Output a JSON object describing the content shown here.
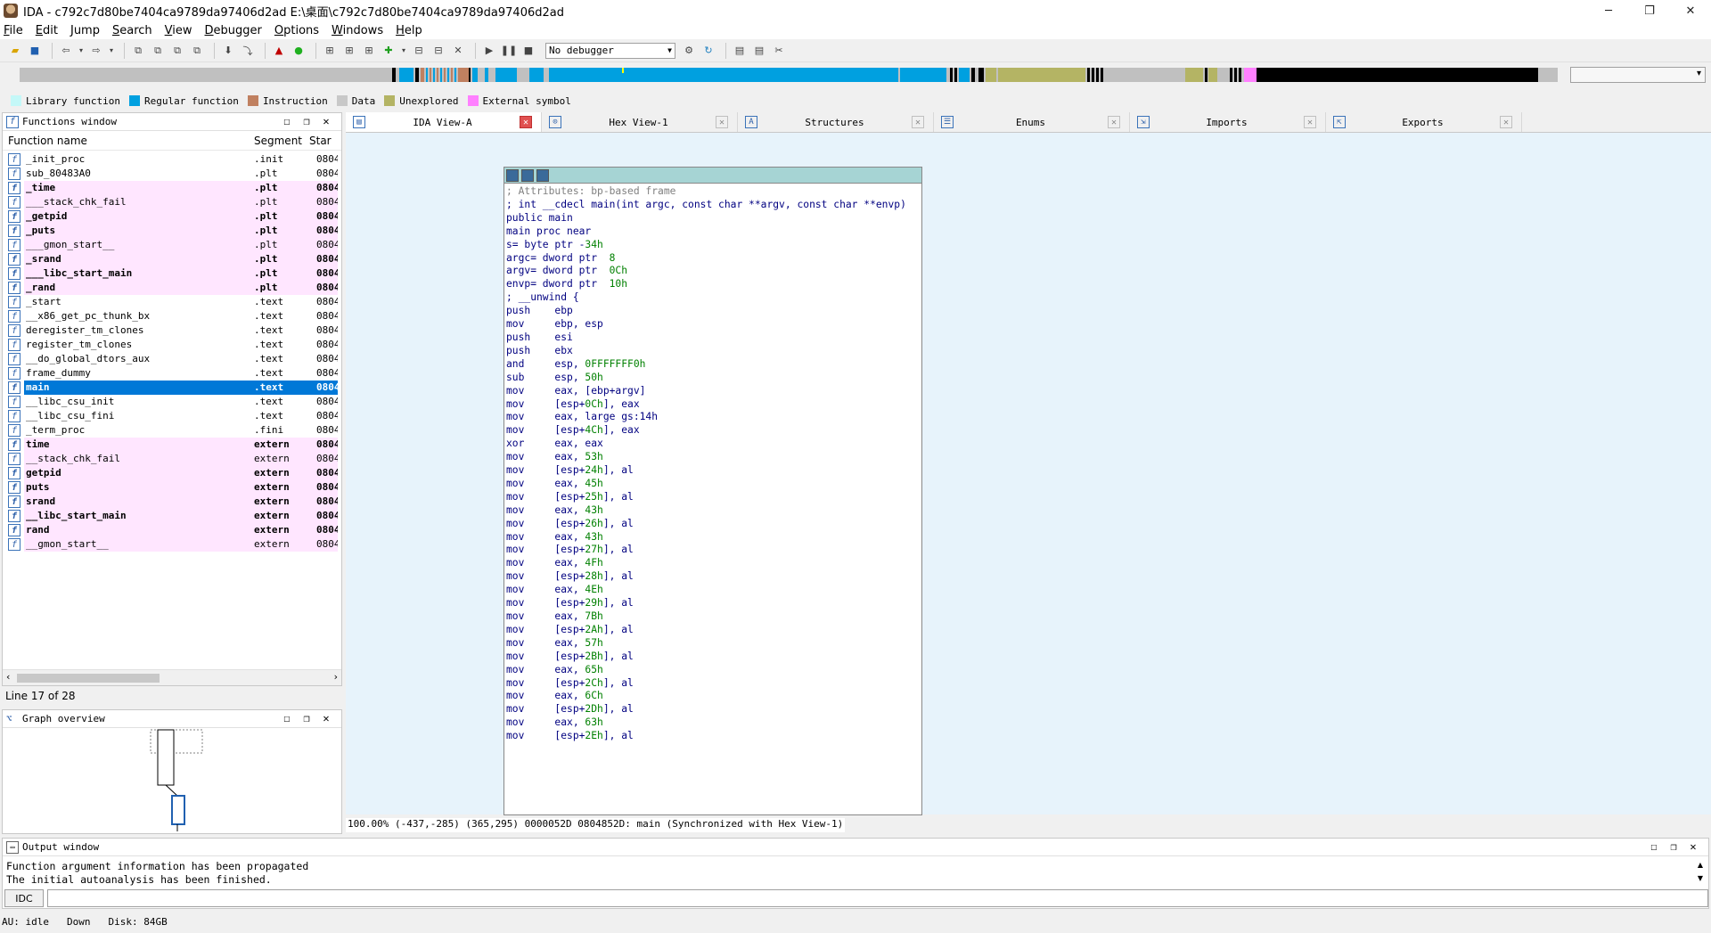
{
  "window": {
    "title": "IDA - c792c7d80be7404ca9789da97406d2ad E:\\桌面\\c792c7d80be7404ca9789da97406d2ad",
    "minimize": "─",
    "restore": "❐",
    "close": "✕"
  },
  "menu": [
    "File",
    "Edit",
    "Jump",
    "Search",
    "View",
    "Debugger",
    "Options",
    "Windows",
    "Help"
  ],
  "toolbar": {
    "debugger_select": "No debugger"
  },
  "legend": [
    {
      "label": "Library function",
      "color": "#c4f8f8"
    },
    {
      "label": "Regular function",
      "color": "#00a0e0"
    },
    {
      "label": "Instruction",
      "color": "#c08060"
    },
    {
      "label": "Data",
      "color": "#c8c8c8"
    },
    {
      "label": "Unexplored",
      "color": "#b4b464"
    },
    {
      "label": "External symbol",
      "color": "#ff80ff"
    }
  ],
  "functions_window": {
    "title": "Functions window",
    "col_name": "Function name",
    "col_segment": "Segment",
    "col_start": "Star",
    "rows": [
      {
        "name": "_init_proc",
        "segment": ".init",
        "start": "0804",
        "bold": false,
        "ext": false
      },
      {
        "name": "sub_80483A0",
        "segment": ".plt",
        "start": "0804",
        "bold": false,
        "ext": false
      },
      {
        "name": "_time",
        "segment": ".plt",
        "start": "0804",
        "bold": true,
        "ext": true
      },
      {
        "name": "___stack_chk_fail",
        "segment": ".plt",
        "start": "0804",
        "bold": false,
        "ext": true
      },
      {
        "name": "_getpid",
        "segment": ".plt",
        "start": "0804",
        "bold": true,
        "ext": true
      },
      {
        "name": "_puts",
        "segment": ".plt",
        "start": "0804",
        "bold": true,
        "ext": true
      },
      {
        "name": "___gmon_start__",
        "segment": ".plt",
        "start": "0804",
        "bold": false,
        "ext": true
      },
      {
        "name": "_srand",
        "segment": ".plt",
        "start": "0804",
        "bold": true,
        "ext": true
      },
      {
        "name": "___libc_start_main",
        "segment": ".plt",
        "start": "0804",
        "bold": true,
        "ext": true
      },
      {
        "name": "_rand",
        "segment": ".plt",
        "start": "0804",
        "bold": true,
        "ext": true
      },
      {
        "name": "_start",
        "segment": ".text",
        "start": "0804",
        "bold": false,
        "ext": false
      },
      {
        "name": "__x86_get_pc_thunk_bx",
        "segment": ".text",
        "start": "0804",
        "bold": false,
        "ext": false
      },
      {
        "name": "deregister_tm_clones",
        "segment": ".text",
        "start": "0804",
        "bold": false,
        "ext": false
      },
      {
        "name": "register_tm_clones",
        "segment": ".text",
        "start": "0804",
        "bold": false,
        "ext": false
      },
      {
        "name": "__do_global_dtors_aux",
        "segment": ".text",
        "start": "0804",
        "bold": false,
        "ext": false
      },
      {
        "name": "frame_dummy",
        "segment": ".text",
        "start": "0804",
        "bold": false,
        "ext": false
      },
      {
        "name": "main",
        "segment": ".text",
        "start": "0804",
        "bold": true,
        "ext": false,
        "selected": true
      },
      {
        "name": "__libc_csu_init",
        "segment": ".text",
        "start": "0804",
        "bold": false,
        "ext": false
      },
      {
        "name": "__libc_csu_fini",
        "segment": ".text",
        "start": "0804",
        "bold": false,
        "ext": false
      },
      {
        "name": "_term_proc",
        "segment": ".fini",
        "start": "0804",
        "bold": false,
        "ext": false
      },
      {
        "name": "time",
        "segment": "extern",
        "start": "0804",
        "bold": true,
        "ext": true
      },
      {
        "name": "__stack_chk_fail",
        "segment": "extern",
        "start": "0804",
        "bold": false,
        "ext": true
      },
      {
        "name": "getpid",
        "segment": "extern",
        "start": "0804",
        "bold": true,
        "ext": true
      },
      {
        "name": "puts",
        "segment": "extern",
        "start": "0804",
        "bold": true,
        "ext": true
      },
      {
        "name": "srand",
        "segment": "extern",
        "start": "0804",
        "bold": true,
        "ext": true
      },
      {
        "name": "__libc_start_main",
        "segment": "extern",
        "start": "0804",
        "bold": true,
        "ext": true
      },
      {
        "name": "rand",
        "segment": "extern",
        "start": "0804",
        "bold": true,
        "ext": true
      },
      {
        "name": "__gmon_start__",
        "segment": "extern",
        "start": "0804",
        "bold": false,
        "ext": true
      }
    ],
    "line_status": "Line 17 of 28"
  },
  "graph_overview": {
    "title": "Graph overview"
  },
  "tabs": [
    {
      "label": "IDA View-A",
      "icon": "disasm-icon",
      "active": true
    },
    {
      "label": "Hex View-1",
      "icon": "hex-icon",
      "active": false
    },
    {
      "label": "Structures",
      "icon": "struct-icon",
      "active": false
    },
    {
      "label": "Enums",
      "icon": "enum-icon",
      "active": false
    },
    {
      "label": "Imports",
      "icon": "imports-icon",
      "active": false
    },
    {
      "label": "Exports",
      "icon": "exports-icon",
      "active": false
    }
  ],
  "code_lines": [
    {
      "t": "",
      "c": "blk"
    },
    {
      "t": "",
      "c": "blk"
    },
    {
      "t": "; Attributes: bp-based frame",
      "c": "cmt"
    },
    {
      "t": "",
      "c": "blk"
    },
    {
      "t": "; int __cdecl main(int argc, const char **argv, const char **envp)",
      "c": "blk"
    },
    {
      "t": "public main",
      "c": "blk"
    },
    {
      "t": "main proc near",
      "c": "blk"
    },
    {
      "t": "",
      "c": "blk"
    },
    {
      "t": "s= byte ptr -34h",
      "c": "blk"
    },
    {
      "t": "argc= dword ptr  8",
      "c": "blk"
    },
    {
      "t": "argv= dword ptr  0Ch",
      "c": "blk"
    },
    {
      "t": "envp= dword ptr  10h",
      "c": "blk"
    },
    {
      "t": "",
      "c": "blk"
    },
    {
      "t": "; __unwind {",
      "c": "blk"
    },
    {
      "t": "push    ebp",
      "c": "blk"
    },
    {
      "t": "mov     ebp, esp",
      "c": "blk"
    },
    {
      "t": "push    esi",
      "c": "blk"
    },
    {
      "t": "push    ebx",
      "c": "blk"
    },
    {
      "t": "and     esp, 0FFFFFFF0h",
      "c": "blk"
    },
    {
      "t": "sub     esp, 50h",
      "c": "blk"
    },
    {
      "t": "mov     eax, [ebp+argv]",
      "c": "blk"
    },
    {
      "t": "mov     [esp+0Ch], eax",
      "c": "blk"
    },
    {
      "t": "mov     eax, large gs:14h",
      "c": "blk"
    },
    {
      "t": "mov     [esp+4Ch], eax",
      "c": "blk"
    },
    {
      "t": "xor     eax, eax",
      "c": "blk"
    },
    {
      "t": "mov     eax, 53h",
      "c": "blk"
    },
    {
      "t": "mov     [esp+24h], al",
      "c": "blk"
    },
    {
      "t": "mov     eax, 45h",
      "c": "blk"
    },
    {
      "t": "mov     [esp+25h], al",
      "c": "blk"
    },
    {
      "t": "mov     eax, 43h",
      "c": "blk"
    },
    {
      "t": "mov     [esp+26h], al",
      "c": "blk"
    },
    {
      "t": "mov     eax, 43h",
      "c": "blk"
    },
    {
      "t": "mov     [esp+27h], al",
      "c": "blk"
    },
    {
      "t": "mov     eax, 4Fh",
      "c": "blk"
    },
    {
      "t": "mov     [esp+28h], al",
      "c": "blk"
    },
    {
      "t": "mov     eax, 4Eh",
      "c": "blk"
    },
    {
      "t": "mov     [esp+29h], al",
      "c": "blk"
    },
    {
      "t": "mov     eax, 7Bh",
      "c": "blk"
    },
    {
      "t": "mov     [esp+2Ah], al",
      "c": "blk"
    },
    {
      "t": "mov     eax, 57h",
      "c": "blk"
    },
    {
      "t": "mov     [esp+2Bh], al",
      "c": "blk"
    },
    {
      "t": "mov     eax, 65h",
      "c": "blk"
    },
    {
      "t": "mov     [esp+2Ch], al",
      "c": "blk"
    },
    {
      "t": "mov     eax, 6Ch",
      "c": "blk"
    },
    {
      "t": "mov     [esp+2Dh], al",
      "c": "blk"
    },
    {
      "t": "mov     eax, 63h",
      "c": "blk"
    },
    {
      "t": "mov     [esp+2Eh], al",
      "c": "blk"
    }
  ],
  "view_status": "100.00% (-437,-285) (365,295) 0000052D 0804852D: main (Synchronized with Hex View-1)",
  "output_window": {
    "title": "Output window",
    "lines": [
      "Function argument information has been propagated",
      "The initial autoanalysis has been finished."
    ],
    "idc_label": "IDC"
  },
  "statusbar": {
    "au": "AU:  idle",
    "direction": "Down",
    "disk": "Disk: 84GB"
  }
}
